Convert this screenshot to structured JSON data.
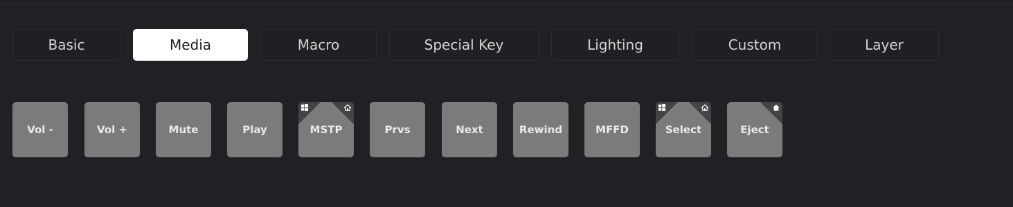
{
  "tabs": [
    {
      "label": "Basic",
      "active": false
    },
    {
      "label": "Media",
      "active": true
    },
    {
      "label": "Macro",
      "active": false
    },
    {
      "label": "Special Key",
      "active": false
    },
    {
      "label": "Lighting",
      "active": false
    },
    {
      "label": "Custom",
      "active": false
    },
    {
      "label": "Layer",
      "active": false
    }
  ],
  "keys": [
    {
      "label": "Vol -"
    },
    {
      "label": "Vol +"
    },
    {
      "label": "Mute"
    },
    {
      "label": "Play"
    },
    {
      "label": "MSTP",
      "corner_icons": [
        "windows-icon",
        "home-outline-icon"
      ]
    },
    {
      "label": "Prvs"
    },
    {
      "label": "Next"
    },
    {
      "label": "Rewind"
    },
    {
      "label": "MFFD"
    },
    {
      "label": "Select",
      "corner_icons": [
        "windows-icon",
        "home-outline-icon"
      ]
    },
    {
      "label": "Eject",
      "corner_icons": [
        "home-filled-icon"
      ]
    }
  ],
  "colors": {
    "background": "#202124",
    "tab_border": "#2c2e31",
    "tab_active_bg": "#ffffff",
    "key_bg": "#7b7b7b",
    "key_corner": "#444446"
  }
}
